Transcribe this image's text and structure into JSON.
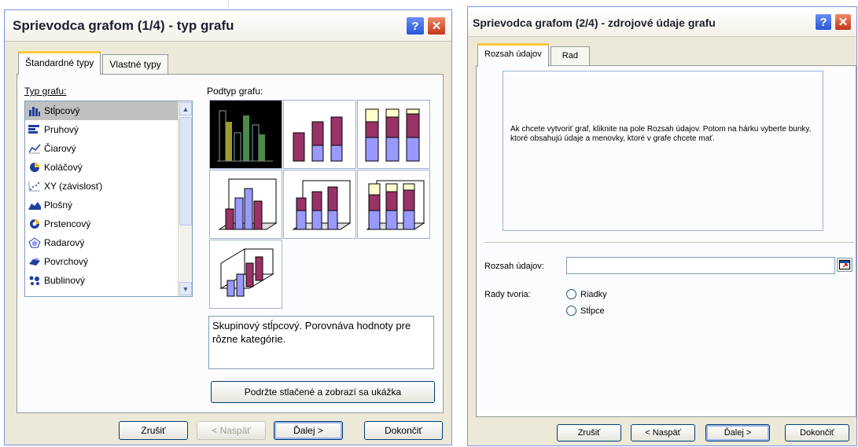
{
  "left": {
    "title": "Sprievodca grafom (1/4) - typ grafu",
    "help_glyph": "?",
    "close_glyph": "✕",
    "tabs": [
      {
        "label": "Štandardné typy"
      },
      {
        "label": "Vlastné typy"
      }
    ],
    "chart_type_label": "Typ grafu:",
    "chart_subtype_label": "Podtyp grafu:",
    "chart_types": [
      {
        "label": "Stĺpcový",
        "icon": "column-chart-icon"
      },
      {
        "label": "Pruhový",
        "icon": "bar-chart-icon"
      },
      {
        "label": "Čiarový",
        "icon": "line-chart-icon"
      },
      {
        "label": "Koláčový",
        "icon": "pie-chart-icon"
      },
      {
        "label": "XY (závislosť)",
        "icon": "scatter-chart-icon"
      },
      {
        "label": "Plošný",
        "icon": "area-chart-icon"
      },
      {
        "label": "Prstencový",
        "icon": "doughnut-chart-icon"
      },
      {
        "label": "Radarový",
        "icon": "radar-chart-icon"
      },
      {
        "label": "Povrchový",
        "icon": "surface-chart-icon"
      },
      {
        "label": "Bublinový",
        "icon": "bubble-chart-icon"
      }
    ],
    "selected_type": "Stĺpcový",
    "description": "Skupinový stĺpcový. Porovnáva hodnoty pre rôzne kategórie.",
    "preview_button": "Podržte stlačené a zobrazí sa ukážka",
    "buttons": {
      "cancel": "Zrušiť",
      "back": "< Naspäť",
      "next": "Ďalej >",
      "finish": "Dokončiť"
    }
  },
  "right": {
    "title": "Sprievodca grafom (2/4) - zdrojové údaje grafu",
    "help_glyph": "?",
    "close_glyph": "✕",
    "tabs": [
      {
        "label": "Rozsah údajov"
      },
      {
        "label": "Rad"
      }
    ],
    "info_text": "Ak chcete vytvoriť graf, kliknite na pole Rozsah údajov. Potom na hárku vyberte bunky, ktoré obsahujú údaje a menovky, ktoré v grafe chcete mať.",
    "range_label": "Rozsah údajov:",
    "range_value": "",
    "series_label": "Rady tvoria:",
    "series_options": [
      {
        "label": "Riadky"
      },
      {
        "label": "Stĺpce"
      }
    ],
    "buttons": {
      "cancel": "Zrušiť",
      "back": "< Naspäť",
      "next": "Ďalej >",
      "finish": "Dokončiť"
    }
  },
  "colors": {
    "dialog_bg": "#ece9d8",
    "bar_purple": "#993366",
    "bar_lavender": "#9999ff",
    "bar_cream": "#ffffcc",
    "selection_gray": "#c0c0c0"
  }
}
